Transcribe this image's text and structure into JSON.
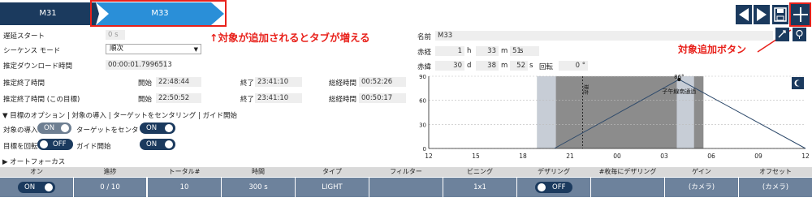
{
  "tabs": [
    {
      "label": "M31"
    },
    {
      "label": "M33"
    }
  ],
  "annotations": {
    "tab_note": "↑対象が追加されるとタブが増える",
    "add_note": "対象追加ボタン"
  },
  "left": {
    "delay_start_label": "遅延スタート",
    "delay_start_value": "0",
    "delay_start_unit": "s",
    "sequence_mode_label": "シーケンス モード",
    "sequence_mode_value": "順次",
    "est_download_label": "推定ダウンロード時間",
    "est_download_value": "00:00:01.7996513",
    "est_end_label": "推定終了時間",
    "est_end_target_label": "推定終了時間 (この目標)",
    "start_label": "開始",
    "end_label": "終了",
    "total_label": "総経時間",
    "row1": {
      "start": "22:48:44",
      "end": "23:41:10",
      "total": "00:52:26"
    },
    "row2": {
      "start": "22:50:52",
      "end": "23:41:10",
      "total": "00:50:17"
    }
  },
  "options": {
    "header": "▼ 目標のオプション | 対象の導入 | ターゲットをセンタリング | ガイド開始",
    "intro_label": "対象の導入",
    "intro_state": "ON",
    "center_label": "ターゲットをセンタリング",
    "center_state": "ON",
    "rotate_label": "目標を回転",
    "rotate_state": "OFF",
    "guide_label": "ガイド開始",
    "guide_state": "ON",
    "autofocus": "▶ オートフォーカス"
  },
  "target": {
    "name_label": "名前",
    "name_value": "M33",
    "ra_label": "赤経",
    "ra_h": "1",
    "ra_h_unit": "h",
    "ra_m": "33",
    "ra_m_unit": "m",
    "ra_s": "51",
    "ra_s_unit": "s",
    "dec_label": "赤緯",
    "dec_d": "30",
    "dec_d_unit": "d",
    "dec_m": "38",
    "dec_m_unit": "m",
    "dec_s": "52",
    "dec_s_unit": "s",
    "rotation_label": "回転",
    "rotation_value": "0",
    "rotation_unit": "°"
  },
  "chart_data": {
    "type": "line",
    "x_ticks": [
      "12",
      "15",
      "18",
      "21",
      "00",
      "03",
      "06",
      "09",
      "12"
    ],
    "y_ticks": [
      "0",
      "30",
      "60",
      "90"
    ],
    "ylim": [
      0,
      90
    ],
    "series": [
      {
        "name": "",
        "x": [
          20.0,
          27.95,
          36.0
        ],
        "y": [
          0,
          86,
          0
        ]
      }
    ],
    "peak_label": "86°",
    "transit_label": "子午線南通過",
    "now_label": "現在",
    "night_band": [
      18.9,
      29.5
    ],
    "twilight_band": [
      18.9,
      20.1
    ],
    "twilight_band2": [
      27.8,
      28.9
    ]
  },
  "table": {
    "headers": [
      "オン",
      "進捗",
      "トータル#",
      "時間",
      "タイプ",
      "フィルター",
      "ビニング",
      "デザリング",
      "#枚毎にデザリング",
      "ゲイン",
      "オフセット"
    ],
    "row": [
      "ON",
      "0 / 10",
      "10",
      "300 s",
      "LIGHT",
      "",
      "1x1",
      "OFF",
      "",
      "(カメラ)",
      "(カメラ)"
    ]
  },
  "colors": {
    "navy": "#1b3a5e",
    "tab_active": "#2a8fd8",
    "accent_red": "#e8211b",
    "cell": "#6d829c"
  }
}
